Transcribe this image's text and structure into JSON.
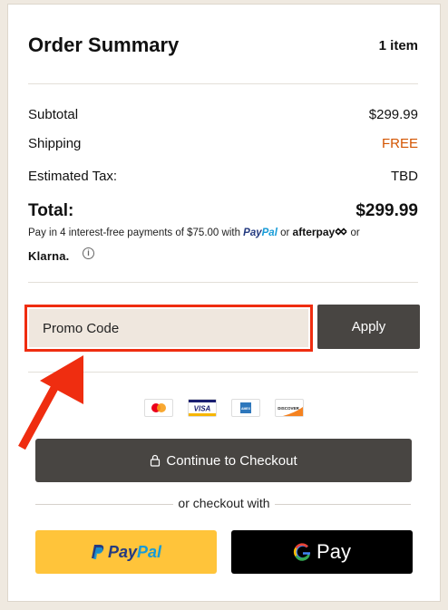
{
  "summary": {
    "title": "Order Summary",
    "item_count": "1 item",
    "subtotal_label": "Subtotal",
    "subtotal_value": "$299.99",
    "shipping_label": "Shipping",
    "shipping_value": "FREE",
    "tax_label": "Estimated Tax:",
    "tax_value": "TBD",
    "total_label": "Total:",
    "total_value": "$299.99"
  },
  "installments": {
    "text": "Pay in 4 interest-free payments of $75.00 with",
    "paypal_pay": "Pay",
    "paypal_pal": "Pal",
    "or1": "or",
    "afterpay": "afterpay",
    "or2": "or",
    "klarna": "Klarna.",
    "info": "i"
  },
  "promo": {
    "placeholder": "Promo Code",
    "apply_label": "Apply"
  },
  "payment_cards": [
    "mastercard-icon",
    "visa-icon",
    "amex-icon",
    "discover-icon"
  ],
  "card_labels": {
    "visa": "VISA",
    "amex": "AMEX",
    "discover": "DISCOVER"
  },
  "checkout": {
    "continue_label": "Continue to Checkout",
    "or_checkout_with": "or checkout with",
    "paypal_pay": "Pay",
    "paypal_pal": "Pal",
    "gpay_g": "G",
    "gpay_label": "Pay"
  },
  "colors": {
    "free": "#d35400",
    "dark_button": "#484542",
    "paypal_button": "#ffc43a",
    "highlight": "#ef2d10",
    "promo_bg": "#efe7de"
  }
}
